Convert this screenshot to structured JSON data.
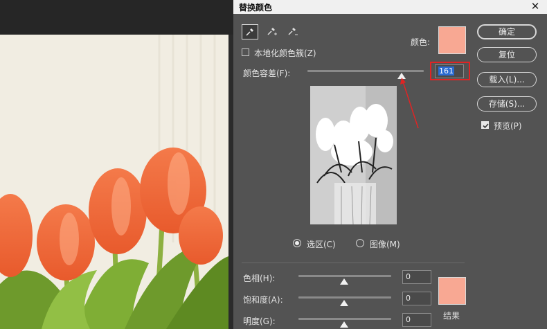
{
  "dialog": {
    "title": "替换颜色",
    "close_glyph": "✕",
    "tools": [
      {
        "name": "eyedropper-icon",
        "active": true
      },
      {
        "name": "eyedropper-plus-icon",
        "active": false
      },
      {
        "name": "eyedropper-minus-icon",
        "active": false
      }
    ],
    "localized_clusters": {
      "label": "本地化颜色簇(Z)",
      "checked": false
    },
    "color": {
      "label": "颜色:",
      "hex": "#f8a893"
    },
    "fuzziness": {
      "label": "颜色容差(F):",
      "value": "161",
      "max": 200
    },
    "view_modes": {
      "selection": {
        "label": "选区(C)",
        "checked": true
      },
      "image": {
        "label": "图像(M)",
        "checked": false
      }
    },
    "replacement": {
      "hue": {
        "label": "色相(H):",
        "value": "0"
      },
      "saturation": {
        "label": "饱和度(A):",
        "value": "0"
      },
      "lightness": {
        "label": "明度(G):",
        "value": "0"
      },
      "result_label": "结果",
      "result_hex": "#f8a893"
    },
    "buttons": {
      "ok": "确定",
      "reset": "复位",
      "load": "载入(L)...",
      "save": "存储(S)..."
    },
    "preview": {
      "label": "预览(P)",
      "checked": true
    }
  },
  "colors": {
    "dialog_bg": "#535353",
    "annotation_red": "#e02424",
    "tulip": "#f26a3c"
  }
}
